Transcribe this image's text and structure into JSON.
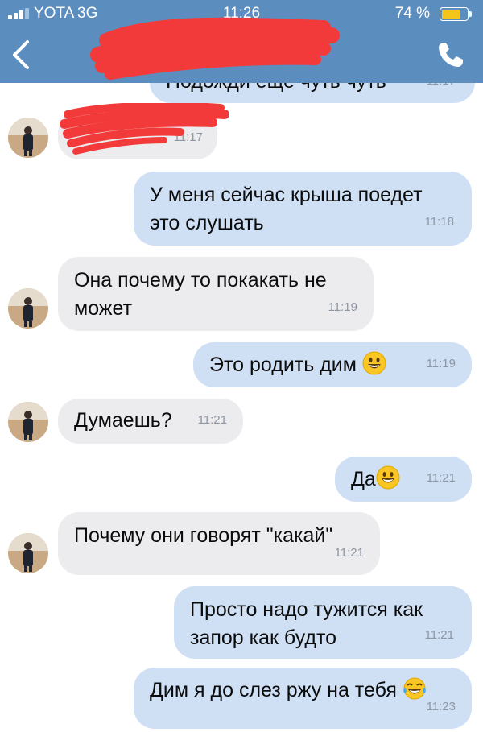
{
  "status_bar": {
    "carrier": "YOTA",
    "network": "3G",
    "time": "11:26",
    "battery_percent": "74 %",
    "battery_level": 0.74
  },
  "header": {
    "back_icon": "chevron-left-icon",
    "call_icon": "phone-icon",
    "contact_name": "",
    "contact_status": "",
    "redacted": true,
    "accent_color": "#5c8dbf"
  },
  "messages": [
    {
      "direction": "out",
      "text": "Подожди еще чуть чуть",
      "time": "11:17",
      "partially_hidden": true
    },
    {
      "direction": "in",
      "text": "",
      "time": "11:17",
      "redacted": true
    },
    {
      "direction": "out",
      "lines": [
        "У меня сейчас крыша поедет",
        "это слушать"
      ],
      "time": "11:18"
    },
    {
      "direction": "in",
      "lines": [
        "Она почему то покакать не",
        "может"
      ],
      "time": "11:19"
    },
    {
      "direction": "out",
      "text": "Это родить дим",
      "emoji": "grinning-face",
      "time": "11:19"
    },
    {
      "direction": "in",
      "text": "Думаешь?",
      "time": "11:21"
    },
    {
      "direction": "out",
      "text": "Да",
      "emoji": "grinning-face",
      "time": "11:21"
    },
    {
      "direction": "in",
      "text": "Почему они говорят \"какай\"",
      "time": "11:21"
    },
    {
      "direction": "out",
      "lines": [
        "Просто надо тужится как",
        "запор как будто"
      ],
      "time": "11:21"
    },
    {
      "direction": "out",
      "text": "Дим я до слез ржу на тебя",
      "emoji": "tears-of-joy",
      "time": "11:23"
    }
  ],
  "colors": {
    "outgoing_bubble": "#cfe0f5",
    "incoming_bubble": "#ececef",
    "time_text": "#8d96a3",
    "redaction": "#f23a3a"
  }
}
